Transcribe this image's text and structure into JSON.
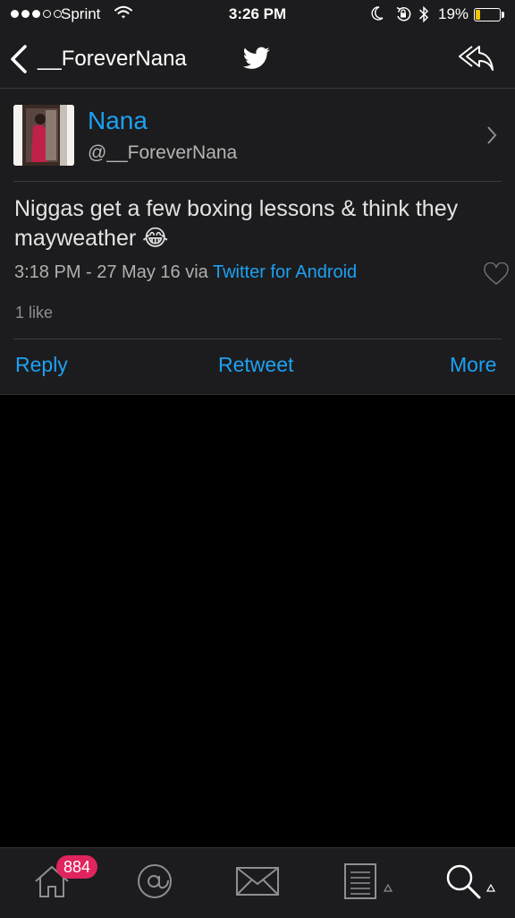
{
  "status_bar": {
    "carrier": "Sprint",
    "time": "3:26 PM",
    "battery_percent": "19%",
    "battery_level": 0.19,
    "signal_bars_filled": 3,
    "signal_bars_total": 5,
    "battery_color": "#f5c400"
  },
  "nav": {
    "title": "__ForeverNana",
    "back_icon": "chevron-left-icon",
    "center_icon": "twitter-bird-icon",
    "right_icon": "reply-all-icon"
  },
  "tweet": {
    "author_name": "Nana",
    "author_handle": "@__ForeverNana",
    "text": "Niggas get a few boxing lessons & think they mayweather 😂",
    "timestamp": "3:18 PM - 27 May 16",
    "via": "via",
    "source": "Twitter for Android",
    "likes": "1 like"
  },
  "actions": {
    "reply": "Reply",
    "retweet": "Retweet",
    "more": "More"
  },
  "tab_bar": {
    "items": [
      {
        "icon": "home-icon",
        "badge": "884"
      },
      {
        "icon": "at-mention-icon"
      },
      {
        "icon": "envelope-icon"
      },
      {
        "icon": "list-icon"
      },
      {
        "icon": "search-icon"
      }
    ]
  },
  "colors": {
    "accent": "#1da1f2",
    "badge": "#e0245e",
    "panel": "#1c1c1e",
    "background": "#000000"
  }
}
